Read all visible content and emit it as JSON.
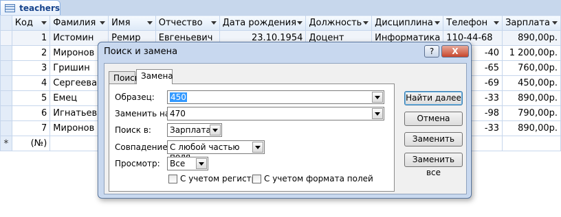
{
  "tab": {
    "title": "teachers",
    "icon": "table-icon"
  },
  "grid": {
    "headers": [
      "Код",
      "Фамилия",
      "Имя",
      "Отчество",
      "Дата рождения",
      "Должность",
      "Дисциплина",
      "Телефон",
      "Зарплата"
    ],
    "row1": {
      "code": "1",
      "last": "Истомин",
      "first": "Ремир",
      "middle": "Евгеньевич",
      "birth": "23.10.1954",
      "position": "Доцент",
      "subject": "Информатика",
      "phone": "110-44-68",
      "salary": "890,00р."
    },
    "rows": [
      {
        "code": "2",
        "last": "Миронов",
        "phone": "-40",
        "salary": "1 200,00р."
      },
      {
        "code": "3",
        "last": "Гришин",
        "phone": "-65",
        "salary": "760,00р."
      },
      {
        "code": "4",
        "last": "Сергеева",
        "phone": "-69",
        "salary": "450,00р."
      },
      {
        "code": "5",
        "last": "Емец",
        "phone": "-33",
        "salary": "890,00р."
      },
      {
        "code": "6",
        "last": "Игнатьева",
        "phone": "-98",
        "salary": "790,00р."
      },
      {
        "code": "7",
        "last": "Миронов",
        "phone": "-33",
        "salary": "890,00р."
      }
    ],
    "new_row_marker": "*",
    "new_row_code": "(№)"
  },
  "dialog": {
    "title": "Поиск и замена",
    "help_button": "?",
    "close_button": "X",
    "tabs": {
      "search": "Поиск",
      "replace": "Замена"
    },
    "find_label": "Образец:",
    "find_value": "450",
    "replace_label": "Заменить на:",
    "replace_value": "470",
    "look_in_label": "Поиск в:",
    "look_in_value": "Зарплата",
    "match_label": "Совпадение:",
    "match_value": "С любой частью поля",
    "search_label": "Просмотр:",
    "search_value": "Все",
    "match_case_label": "С учетом регистра",
    "match_format_label": "С учетом формата полей",
    "buttons": {
      "find_next": "Найти далее",
      "cancel": "Отмена",
      "replace": "Заменить",
      "replace_all": "Заменить все"
    }
  }
}
